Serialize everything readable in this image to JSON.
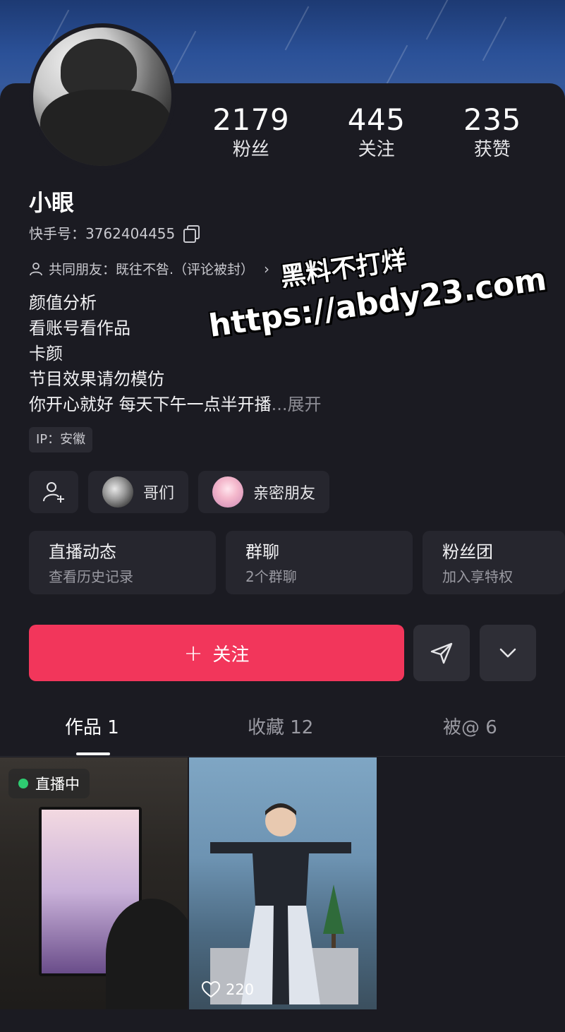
{
  "profile": {
    "stats": [
      {
        "value": "2179",
        "label": "粉丝"
      },
      {
        "value": "445",
        "label": "关注"
      },
      {
        "value": "235",
        "label": "获赞"
      }
    ],
    "name": "小眼",
    "id_label": "快手号：3762404455",
    "mutual_friends": "共同朋友：既往不咎.（评论被封）",
    "bio_lines": [
      "颜值分析",
      "看账号看作品",
      "卡颜",
      "节目效果请勿模仿",
      "你开心就好 每天下午一点半开播"
    ],
    "bio_ellipsis": "...",
    "bio_more": "展开",
    "ip": "IP：安徽"
  },
  "chips": {
    "add_icon": "add-user-icon",
    "group1": "哥们",
    "group2": "亲密朋友"
  },
  "cards": [
    {
      "title": "直播动态",
      "subtitle": "查看历史记录"
    },
    {
      "title": "群聊",
      "subtitle": "2个群聊"
    },
    {
      "title": "粉丝团",
      "subtitle": "加入享特权"
    }
  ],
  "actions": {
    "follow_plus": "+",
    "follow_label": "关注",
    "message_icon": "send-icon",
    "more_icon": "chevron-down-icon",
    "accent_color": "#f2365b"
  },
  "tabs": [
    {
      "label": "作品 1"
    },
    {
      "label": "收藏 12"
    },
    {
      "label": "被@ 6"
    }
  ],
  "posts": {
    "live_label": "直播中",
    "likes": "220"
  },
  "watermark": {
    "line1": "黑料不打烊",
    "line2": "https://abdy23.com"
  }
}
